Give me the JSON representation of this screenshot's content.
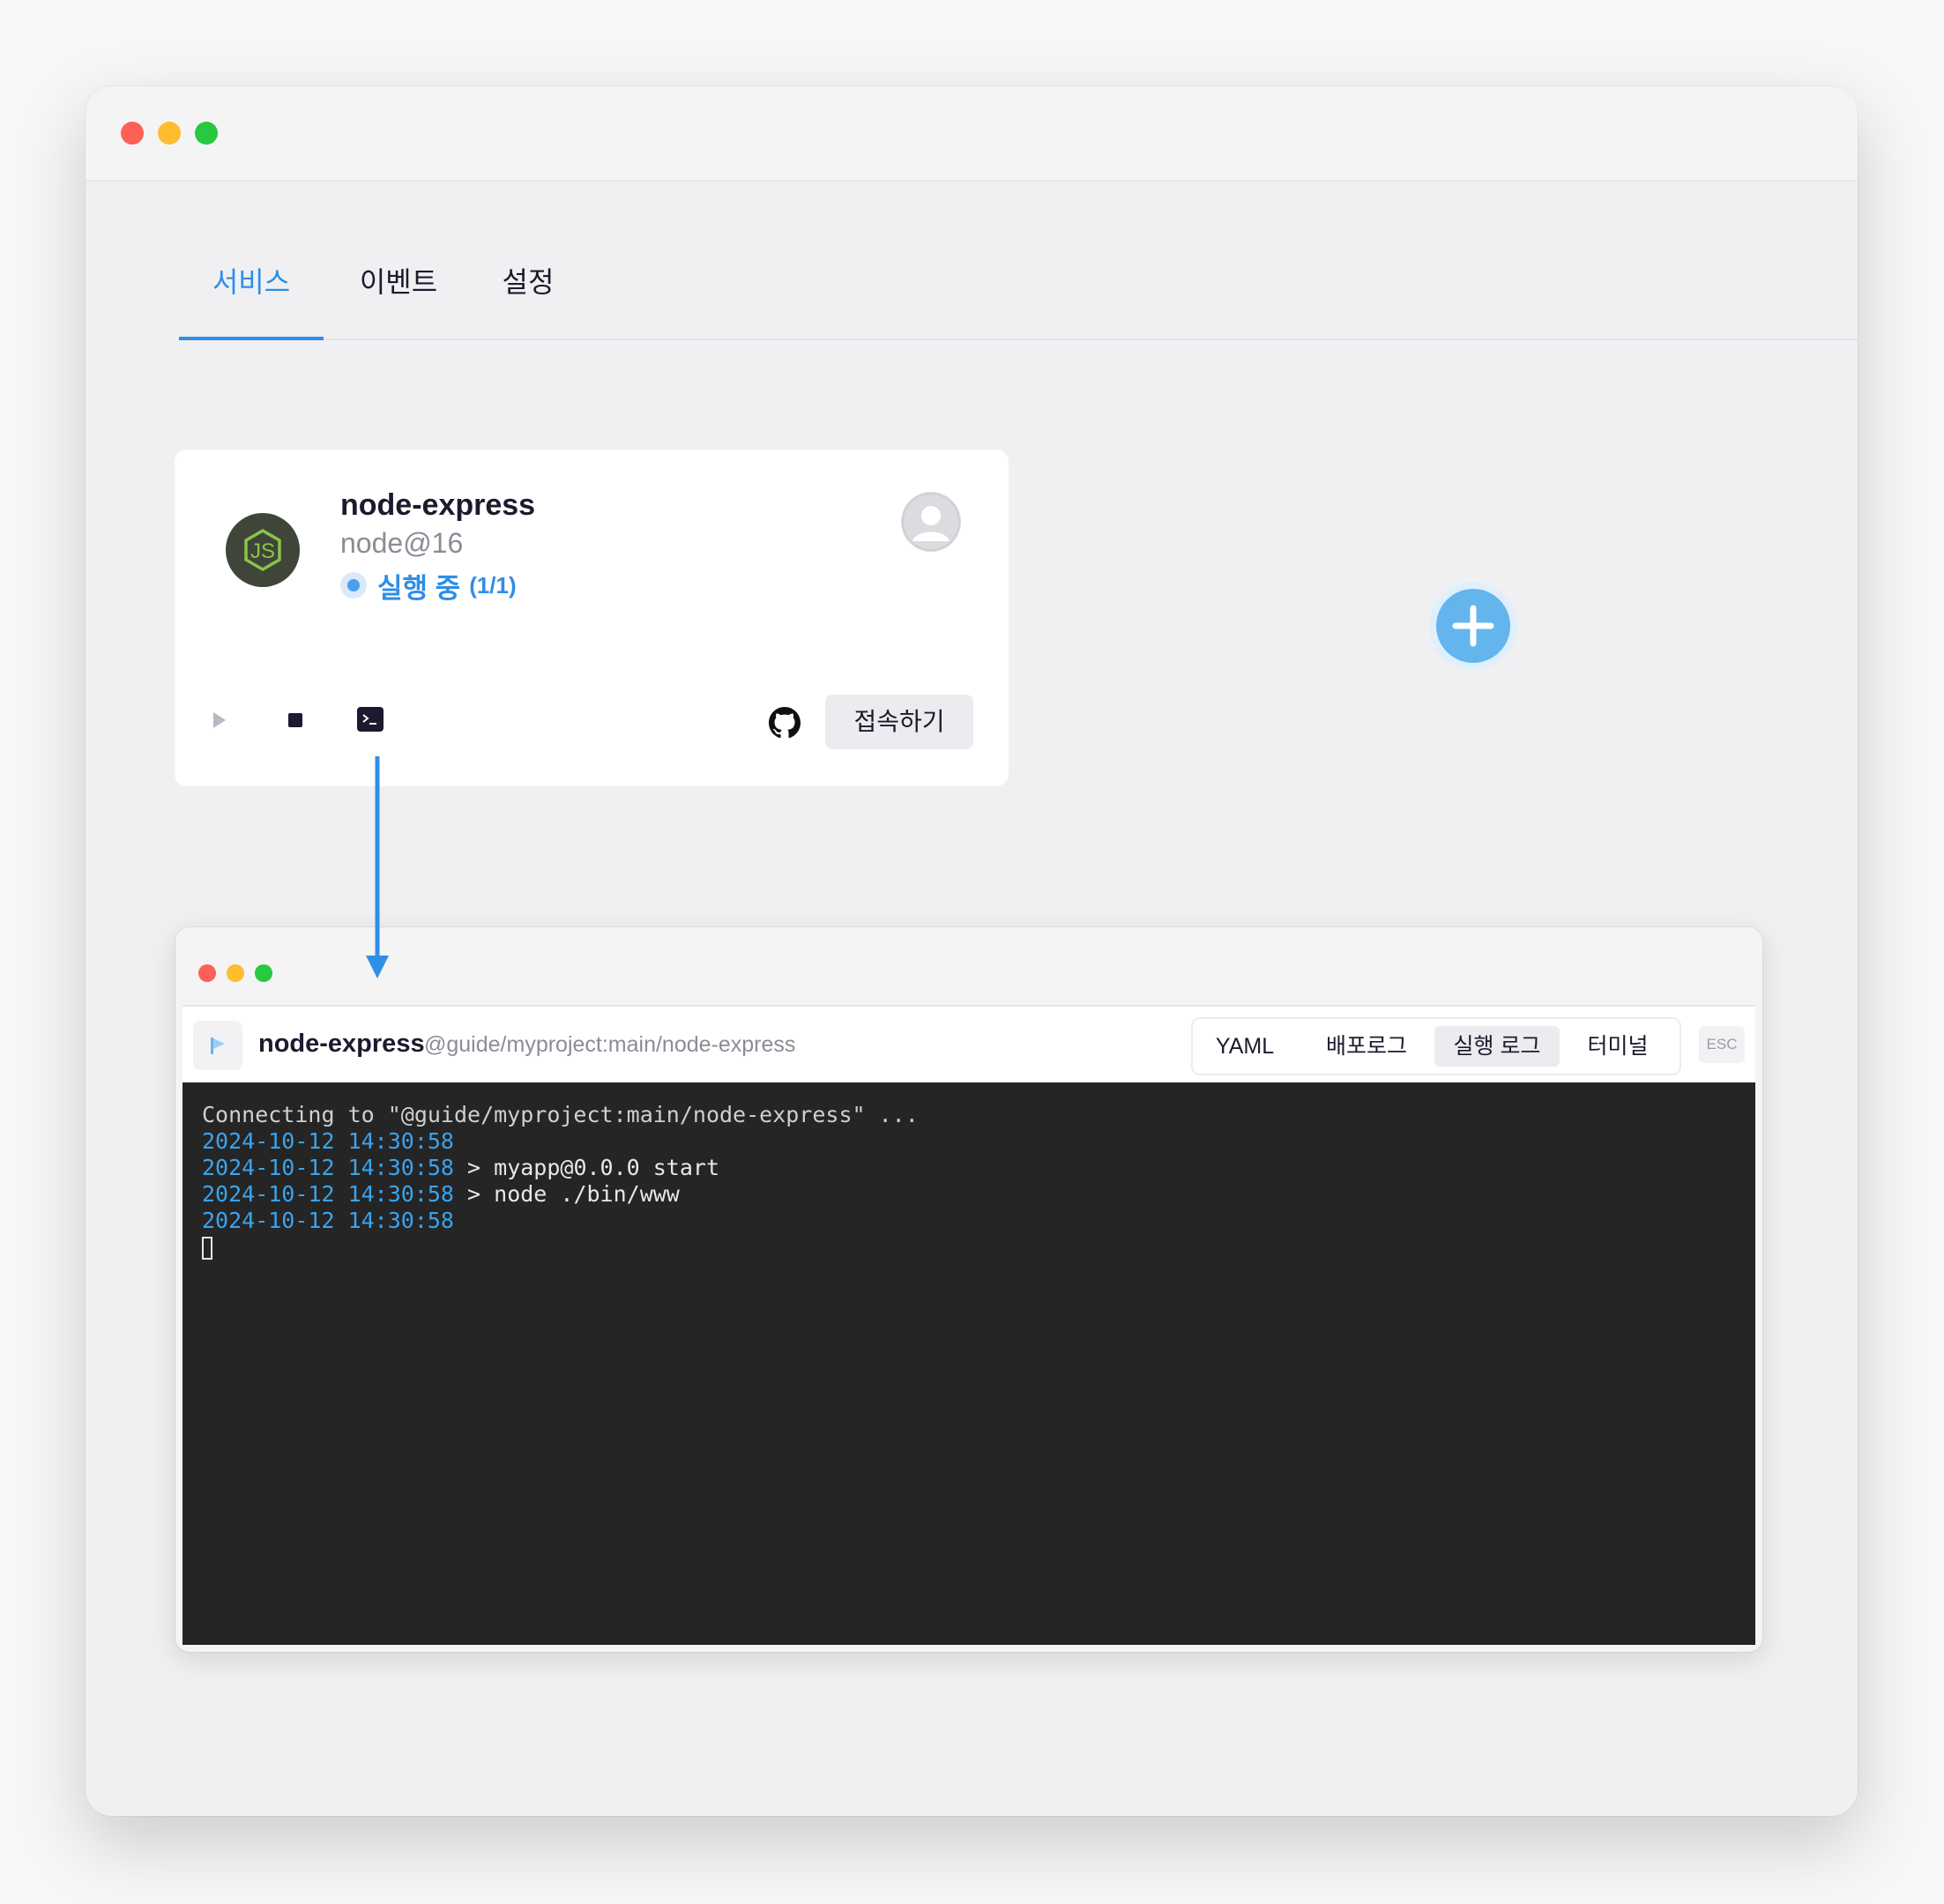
{
  "tabs": [
    {
      "label": "서비스",
      "active": true
    },
    {
      "label": "이벤트",
      "active": false
    },
    {
      "label": "설정",
      "active": false
    }
  ],
  "service_card": {
    "name": "node-express",
    "runtime": "node@16",
    "status_text": "실행 중",
    "status_count": "(1/1)",
    "connect_label": "접속하기",
    "icons": [
      "nodejs-icon",
      "avatar-icon",
      "play-icon",
      "stop-icon",
      "terminal-icon",
      "github-icon"
    ]
  },
  "add_button": {
    "icon": "plus-icon"
  },
  "terminal": {
    "service_name": "node-express",
    "service_path": "@guide/myproject:main/node-express",
    "tabs": [
      {
        "label": "YAML",
        "active": false
      },
      {
        "label": "배포로그",
        "active": false
      },
      {
        "label": "실행 로그",
        "active": true
      },
      {
        "label": "터미널",
        "active": false
      }
    ],
    "esc_label": "ESC",
    "connecting_line": "Connecting to \"@guide/myproject:main/node-express\" ...",
    "log_lines": [
      {
        "ts": "2024-10-12 14:30:58",
        "text": ""
      },
      {
        "ts": "2024-10-12 14:30:58",
        "text": " > myapp@0.0.0 start"
      },
      {
        "ts": "2024-10-12 14:30:58",
        "text": " > node ./bin/www"
      },
      {
        "ts": "2024-10-12 14:30:58",
        "text": ""
      }
    ]
  },
  "colors": {
    "accent": "#2f8ee6",
    "terminal_bg": "#252525",
    "timestamp": "#3aa3ef",
    "node_badge": "#3f4538",
    "node_green": "#8bc34a"
  }
}
